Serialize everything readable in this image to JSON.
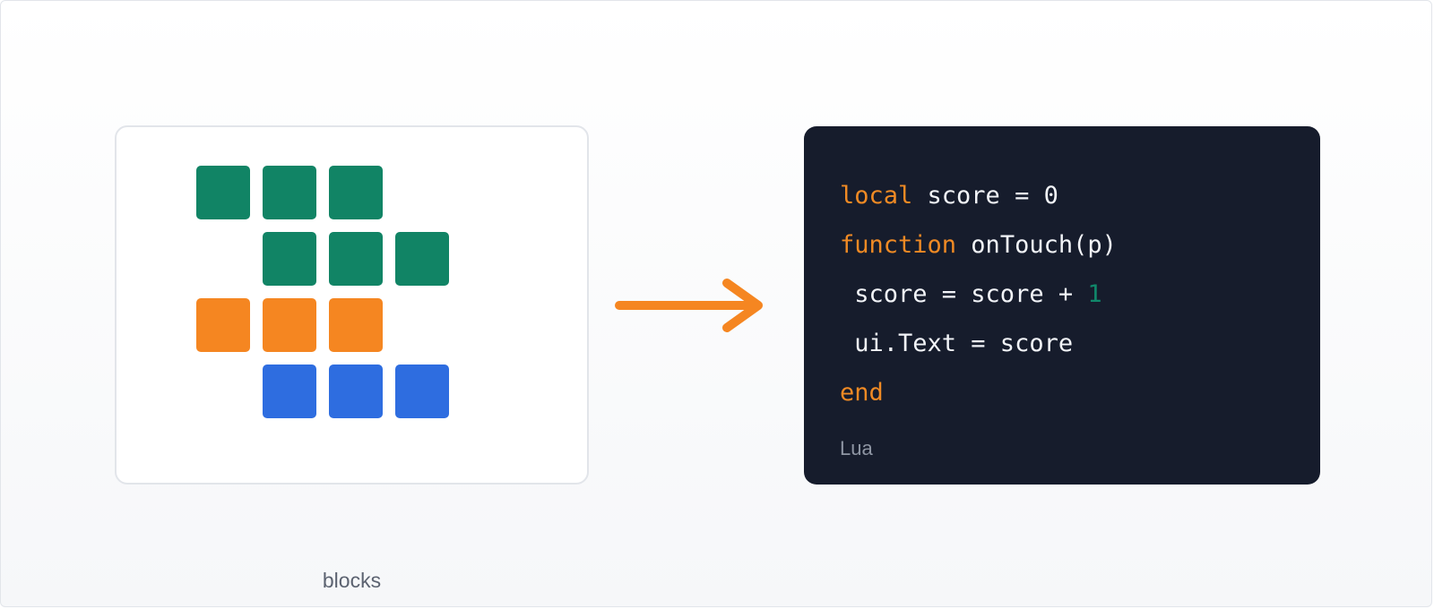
{
  "blocks": {
    "caption": "blocks",
    "rows": [
      {
        "color": "#118465",
        "cells": [
          1,
          1,
          1,
          0
        ]
      },
      {
        "color": "#118465",
        "cells": [
          0,
          1,
          1,
          1
        ]
      },
      {
        "color": "#f58621",
        "cells": [
          1,
          1,
          1,
          0
        ]
      },
      {
        "color": "#2e6de0",
        "cells": [
          0,
          1,
          1,
          1
        ]
      }
    ]
  },
  "arrow": {
    "color": "#f58621"
  },
  "code": {
    "language": "Lua",
    "lines": [
      {
        "keyword": "local",
        "rest": " score = 0"
      },
      {
        "keyword": "function",
        "rest": " onTouch(p)"
      },
      {
        "text": " score = score + ",
        "number": "1"
      },
      {
        "text": " ui.Text = score"
      },
      {
        "keyword": "end"
      }
    ]
  }
}
